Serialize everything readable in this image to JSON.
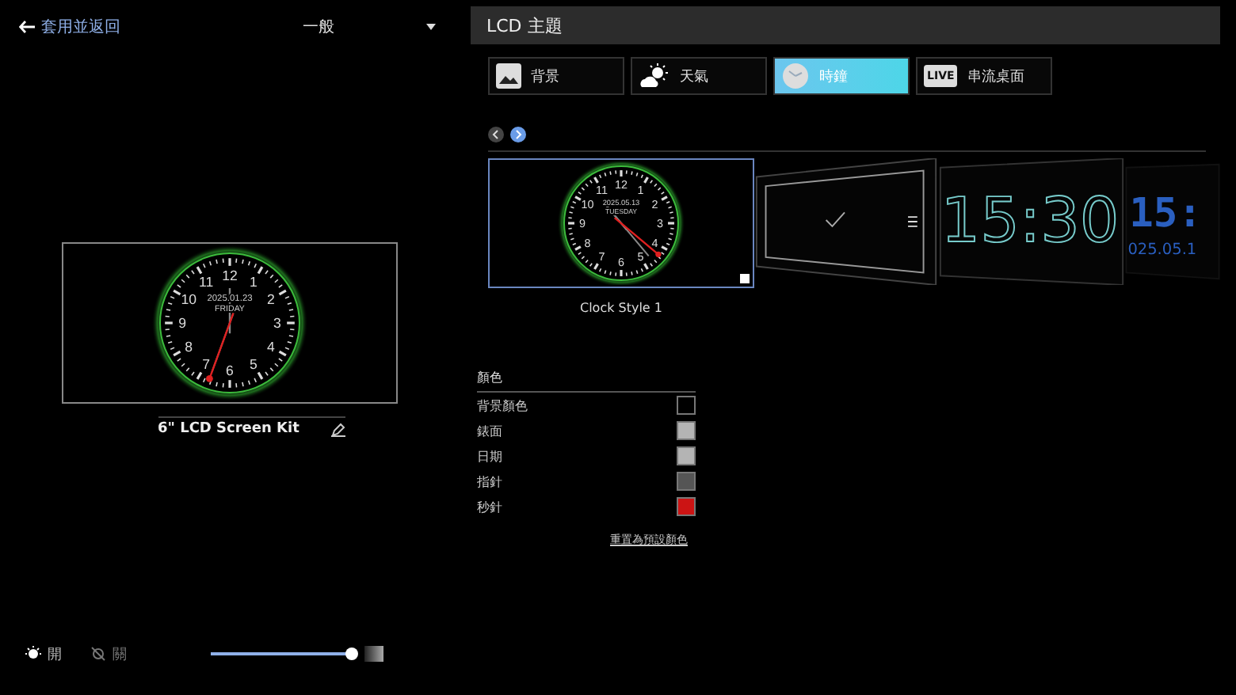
{
  "back_link": {
    "label": "套用並返回"
  },
  "dropdown": {
    "value": "一般"
  },
  "preview": {
    "numerals": [
      "11",
      "12",
      "1",
      "10",
      "2",
      "9",
      "3",
      "8",
      "4",
      "7",
      "6",
      "5"
    ],
    "date": "2025.01.23",
    "day": "FRIDAY",
    "device_name": "6\" LCD Screen Kit"
  },
  "light_toggle": [
    {
      "label": "開",
      "selected": true
    },
    {
      "label": "關",
      "selected": false
    }
  ],
  "brightness": {
    "level": 1.0
  },
  "panel": {
    "title": "LCD 主題"
  },
  "tabs": [
    {
      "label": "背景",
      "kind": "picture",
      "selected": false
    },
    {
      "label": "天氣",
      "kind": "weather",
      "selected": false
    },
    {
      "label": "時鐘",
      "kind": "clock",
      "selected": true
    },
    {
      "label": "串流桌面",
      "kind": "live",
      "icon_text": "LIVE",
      "selected": false
    }
  ],
  "carousel": {
    "items": [
      {
        "kind": "analog",
        "label": "Clock Style 1",
        "selected": true,
        "numerals": [
          "11",
          "12",
          "1",
          "10",
          "2",
          "9",
          "3",
          "8",
          "4",
          "7",
          "6",
          "5"
        ],
        "date": "2025.05.13",
        "day": "TUESDAY"
      },
      {
        "kind": "roman",
        "selected": false
      },
      {
        "kind": "digital",
        "selected": false,
        "time": "15:30"
      },
      {
        "kind": "dotmatrix",
        "selected": false,
        "time": "15:",
        "date": "025.05.1"
      }
    ]
  },
  "colors": {
    "title": "顏色",
    "items": [
      {
        "label": "背景顏色",
        "color": "#000000"
      },
      {
        "label": "錶面",
        "color": "#b4b4b4"
      },
      {
        "label": "日期",
        "color": "#b4b4b4"
      },
      {
        "label": "指針",
        "color": "#555555"
      },
      {
        "label": "秒針",
        "color": "#cc1414"
      }
    ],
    "reset_link": "重置為預設顏色"
  }
}
